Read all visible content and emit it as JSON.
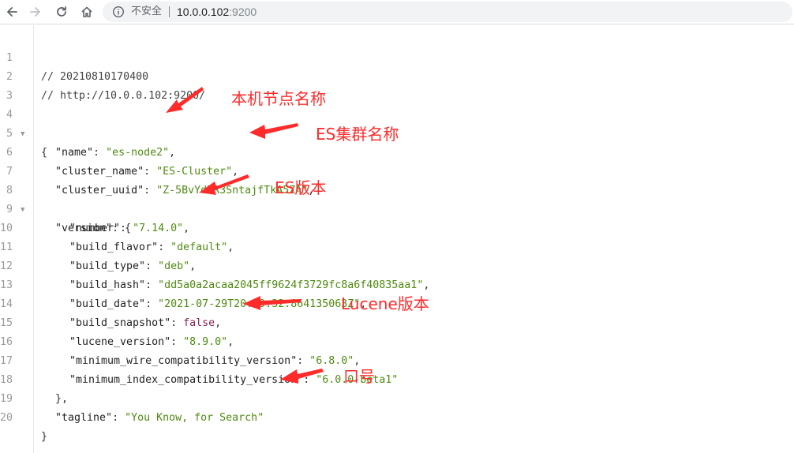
{
  "browser": {
    "security_label": "不安全",
    "url_host": "10.0.0.102",
    "url_port": ":9200"
  },
  "lines": [
    {
      "num": "1"
    },
    {
      "num": "2"
    },
    {
      "num": "3"
    },
    {
      "num": "4"
    },
    {
      "num": "5"
    },
    {
      "num": "6"
    },
    {
      "num": "7"
    },
    {
      "num": "8"
    },
    {
      "num": "9"
    },
    {
      "num": "10"
    },
    {
      "num": "11"
    },
    {
      "num": "12"
    },
    {
      "num": "13"
    },
    {
      "num": "14"
    },
    {
      "num": "15"
    },
    {
      "num": "16"
    },
    {
      "num": "17"
    },
    {
      "num": "18"
    },
    {
      "num": "19"
    },
    {
      "num": "20"
    }
  ],
  "json_view": {
    "comment_timestamp": "// 20210810170400",
    "comment_url": "// http://10.0.0.102:9200/",
    "open_brace": "{",
    "close_brace": "}",
    "version_close": "},",
    "name_key": "\"name\"",
    "name_val": "\"es-node2\"",
    "cluster_name_key": "\"cluster_name\"",
    "cluster_name_val": "\"ES-Cluster\"",
    "cluster_uuid_key": "\"cluster_uuid\"",
    "cluster_uuid_val": "\"Z-5BvYdRR3SntajfTkA5ZA\"",
    "version_key": "\"version\"",
    "number_key": "\"number\"",
    "number_val": "\"7.14.0\"",
    "build_flavor_key": "\"build_flavor\"",
    "build_flavor_val": "\"default\"",
    "build_type_key": "\"build_type\"",
    "build_type_val": "\"deb\"",
    "build_hash_key": "\"build_hash\"",
    "build_hash_val": "\"dd5a0a2acaa2045ff9624f3729fc8a6f40835aa1\"",
    "build_date_key": "\"build_date\"",
    "build_date_val": "\"2021-07-29T20:49:32.864135063Z\"",
    "build_snapshot_key": "\"build_snapshot\"",
    "build_snapshot_val": "false",
    "lucene_version_key": "\"lucene_version\"",
    "lucene_version_val": "\"8.9.0\"",
    "min_wire_key": "\"minimum_wire_compatibility_version\"",
    "min_wire_val": "\"6.8.0\"",
    "min_index_key": "\"minimum_index_compatibility_version\"",
    "min_index_val": "\"6.0.0-beta1\"",
    "tagline_key": "\"tagline\"",
    "tagline_val": "\"You Know, for Search\""
  },
  "annotations": {
    "node_name": "本机节点名称",
    "cluster_name": "ES集群名称",
    "es_version": "ES版本",
    "lucene_version": "Lucene版本",
    "tagline": "口号",
    "color": "#ff2b2b"
  },
  "icons": {
    "back": "arrow-left-icon",
    "forward": "arrow-right-icon",
    "reload": "reload-icon",
    "home": "home-icon",
    "info": "info-circle-icon",
    "fold": "fold-triangle-icon"
  }
}
